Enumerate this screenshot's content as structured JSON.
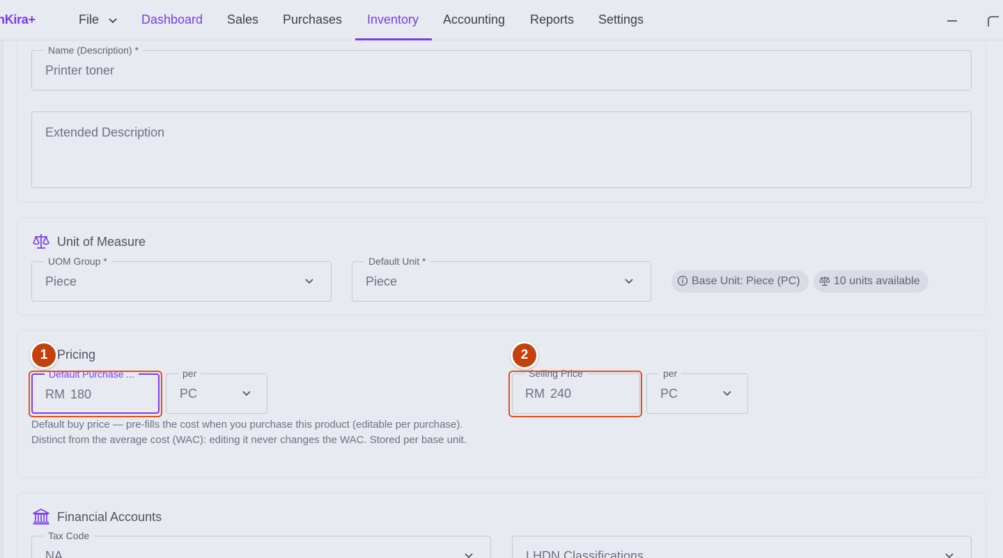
{
  "app": {
    "brand": "nKira+"
  },
  "nav": {
    "file": "File",
    "items": [
      "Dashboard",
      "Sales",
      "Purchases",
      "Inventory",
      "Accounting",
      "Reports",
      "Settings"
    ],
    "active": "Inventory"
  },
  "form": {
    "name_label": "Name (Description) *",
    "name_value": "Printer toner",
    "extended_placeholder": "Extended Description"
  },
  "uom": {
    "title": "Unit of Measure",
    "group_label": "UOM Group *",
    "group_value": "Piece",
    "default_unit_label": "Default Unit *",
    "default_unit_value": "Piece",
    "chip_base_unit": "Base Unit: Piece (PC)",
    "chip_units_available": "10 units available"
  },
  "pricing": {
    "title": "Pricing",
    "purchase_label": "Default Purchase ...",
    "purchase_currency": "RM",
    "purchase_value": "180",
    "purchase_per_label": "per",
    "purchase_per_value": "PC",
    "selling_label": "Selling Price",
    "selling_currency": "RM",
    "selling_value": "240",
    "selling_per_label": "per",
    "selling_per_value": "PC",
    "helper": "Default buy price — pre-fills the cost when you purchase this product (editable per purchase). Distinct from the average cost (WAC): editing it never changes the WAC. Stored per base unit."
  },
  "financial": {
    "title": "Financial Accounts",
    "tax_label": "Tax Code",
    "tax_value": "NA",
    "lhdn_placeholder": "LHDN Classifications"
  },
  "annotations": {
    "badge1": "1",
    "badge2": "2"
  },
  "colors": {
    "accent": "#7c3aed",
    "highlight": "#e0521c",
    "badge": "#c4410c"
  }
}
